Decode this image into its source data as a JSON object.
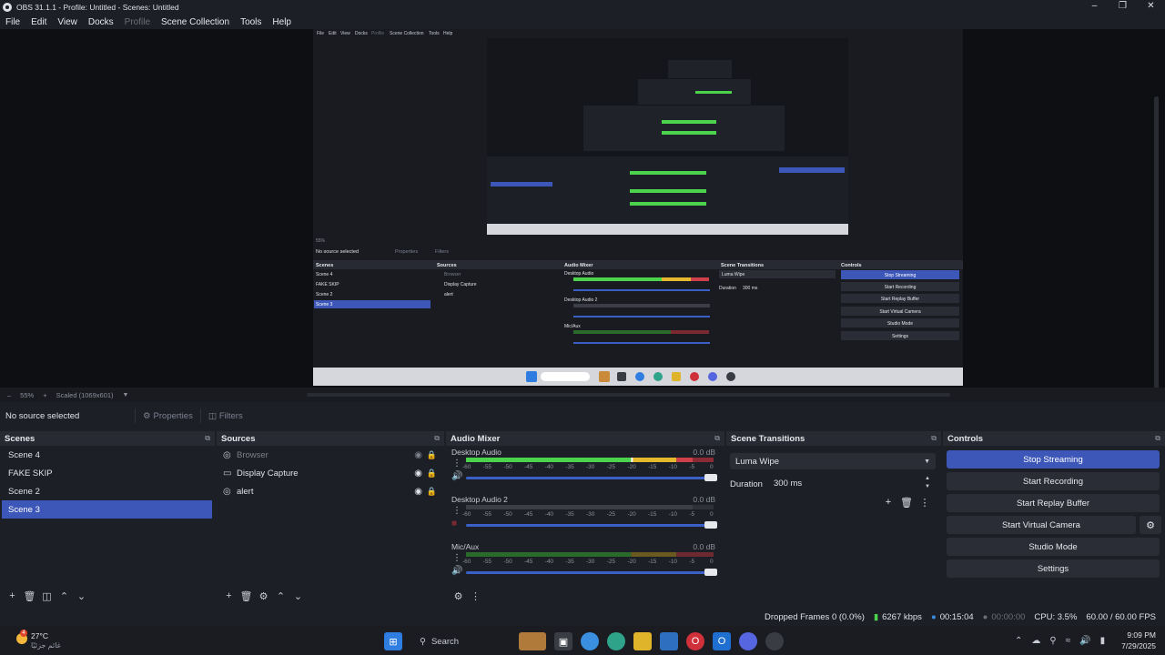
{
  "window": {
    "title": "OBS 31.1.1 - Profile: Untitled - Scenes: Untitled"
  },
  "menu": [
    "File",
    "Edit",
    "View",
    "Docks",
    "Profile",
    "Scene Collection",
    "Tools",
    "Help"
  ],
  "preview": {
    "zoom": "55%",
    "scale_label": "Scaled (1069x601)",
    "nested": {
      "menu": [
        "File",
        "Edit",
        "View",
        "Docks",
        "Profile",
        "Scene Collection",
        "Tools",
        "Help"
      ],
      "context": "No source selected",
      "properties": "Properties",
      "filters": "Filters",
      "docks": [
        "Scenes",
        "Sources",
        "Audio Mixer",
        "Scene Transitions",
        "Controls"
      ],
      "scenes": [
        "Scene 4",
        "FAKE SKIP",
        "Scene 2",
        "Scene 3"
      ],
      "sources": [
        "Browser",
        "Display Capture",
        "alert"
      ],
      "channels": [
        "Desktop Audio",
        "Desktop Audio 2",
        "Mic/Aux"
      ],
      "transition": "Luma Wipe",
      "duration_label": "Duration",
      "duration": "300 ms",
      "controls": [
        "Stop Streaming",
        "Start Recording",
        "Start Replay Buffer",
        "Start Virtual Camera",
        "Studio Mode",
        "Settings"
      ]
    }
  },
  "context_bar": {
    "status": "No source selected",
    "properties": "Properties",
    "filters": "Filters"
  },
  "scenes": {
    "title": "Scenes",
    "items": [
      "Scene 4",
      "FAKE SKIP",
      "Scene 2",
      "Scene 3"
    ],
    "selected_index": 3
  },
  "sources": {
    "title": "Sources",
    "items": [
      {
        "name": "Browser",
        "visible": false
      },
      {
        "name": "Display Capture",
        "visible": true
      },
      {
        "name": "alert",
        "visible": true
      }
    ]
  },
  "mixer": {
    "title": "Audio Mixer",
    "ticks": [
      "-60",
      "-55",
      "-50",
      "-45",
      "-40",
      "-35",
      "-30",
      "-25",
      "-20",
      "-15",
      "-10",
      "-5",
      "0"
    ],
    "channels": [
      {
        "name": "Desktop Audio",
        "db": "0.0 dB",
        "level_db": -20,
        "peak_db": -20,
        "volume": 1.0,
        "muted": false
      },
      {
        "name": "Desktop Audio 2",
        "db": "0.0 dB",
        "level_db": -60,
        "peak_db": -60,
        "volume": 1.0,
        "muted": true
      },
      {
        "name": "Mic/Aux",
        "db": "0.0 dB",
        "level_db": -60,
        "peak_db": -60,
        "volume": 1.0,
        "muted": false
      }
    ]
  },
  "transitions": {
    "title": "Scene Transitions",
    "selected": "Luma Wipe",
    "duration_label": "Duration",
    "duration": "300 ms"
  },
  "controls": {
    "title": "Controls",
    "stop_streaming": "Stop Streaming",
    "start_recording": "Start Recording",
    "start_replay": "Start Replay Buffer",
    "start_virtual_camera": "Start Virtual Camera",
    "studio_mode": "Studio Mode",
    "settings": "Settings"
  },
  "status": {
    "dropped_frames": "Dropped Frames 0 (0.0%)",
    "bitrate": "6267 kbps",
    "stream_time": "00:15:04",
    "record_time": "00:00:00",
    "cpu": "CPU: 3.5%",
    "fps": "60.00 / 60.00 FPS"
  },
  "taskbar": {
    "weather_temp": "27°C",
    "weather_sub": "غائم جزئيًا",
    "weather_badge": "4",
    "search": "Search",
    "time": "9:09 PM",
    "date": "7/29/2025"
  },
  "colors": {
    "accent": "#3d57b9",
    "meter_green": "#4cd34c",
    "meter_yellow": "#e6b82e",
    "meter_red": "#d0404a"
  }
}
